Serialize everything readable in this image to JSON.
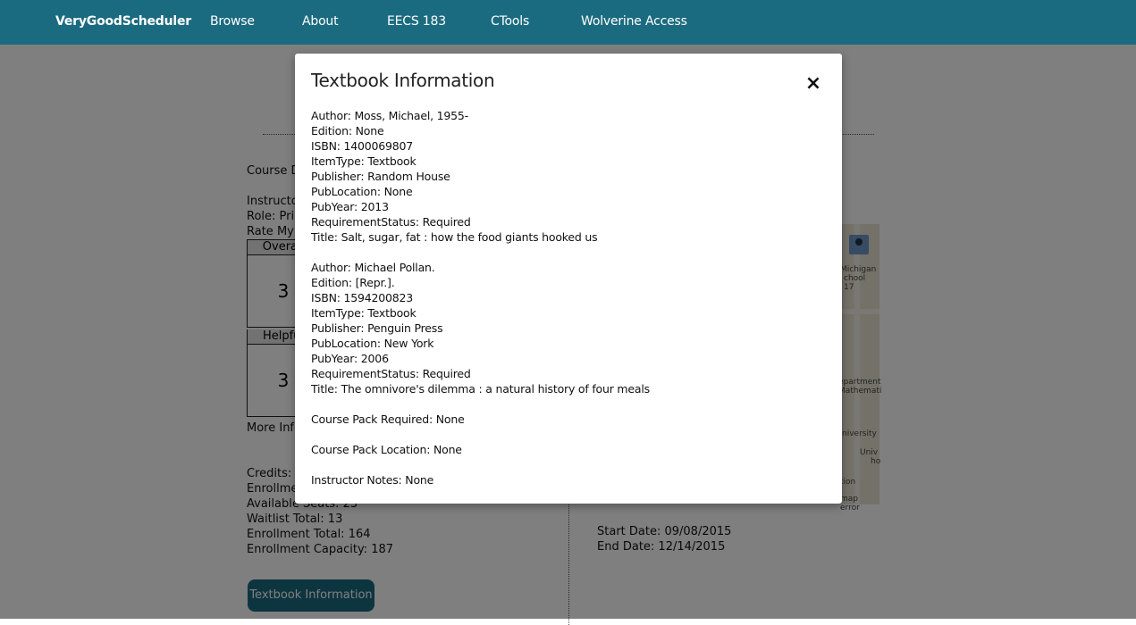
{
  "nav": {
    "brand": "VeryGoodScheduler",
    "items": [
      "Browse",
      "About",
      "EECS 183",
      "CTools",
      "Wolverine Access"
    ]
  },
  "page": {
    "course_desc_label": "Course De",
    "instructor_label": "Instructor",
    "role_label": "Role: Prim",
    "rate_label": "Rate My P",
    "overall_head": "Overall",
    "overall_value": "3",
    "helpful_head": "Helpful",
    "helpful_value": "3",
    "more_info": "More Info",
    "credits": "Credits: 4",
    "enrollment_status": "Enrollment",
    "available_seats": "Available Seats: 23",
    "waitlist_total": "Waitlist Total: 13",
    "enrollment_total": "Enrollment Total: 164",
    "enrollment_capacity": "Enrollment Capacity: 187",
    "start_date": "Start Date: 09/08/2015",
    "end_date": "End Date: 12/14/2015",
    "textbook_button": "Textbook Information",
    "map_labels": [
      "Michigan",
      "chool",
      "17",
      "epartment",
      "Mathemati",
      "niversity",
      "Univ",
      "ho",
      "tion",
      "map error"
    ]
  },
  "modal": {
    "title": "Textbook Information",
    "close_symbol": "×",
    "books": [
      {
        "author": "Author: Moss, Michael, 1955-",
        "edition": "Edition: None",
        "isbn": "ISBN: 1400069807",
        "item_type": "ItemType: Textbook",
        "publisher": "Publisher: Random House",
        "pub_location": "PubLocation: None",
        "pub_year": "PubYear: 2013",
        "requirement": "RequirementStatus: Required",
        "title": "Title: Salt, sugar, fat : how the food giants hooked us"
      },
      {
        "author": "Author: Michael Pollan.",
        "edition": "Edition: [Repr.].",
        "isbn": "ISBN: 1594200823",
        "item_type": "ItemType: Textbook",
        "publisher": "Publisher: Penguin Press",
        "pub_location": "PubLocation: New York",
        "pub_year": "PubYear: 2006",
        "requirement": "RequirementStatus: Required",
        "title": "Title: The omnivore's dilemma : a natural history of four meals"
      }
    ],
    "course_pack_required": "Course Pack Required: None",
    "course_pack_location": "Course Pack Location: None",
    "instructor_notes": "Instructor Notes: None"
  }
}
